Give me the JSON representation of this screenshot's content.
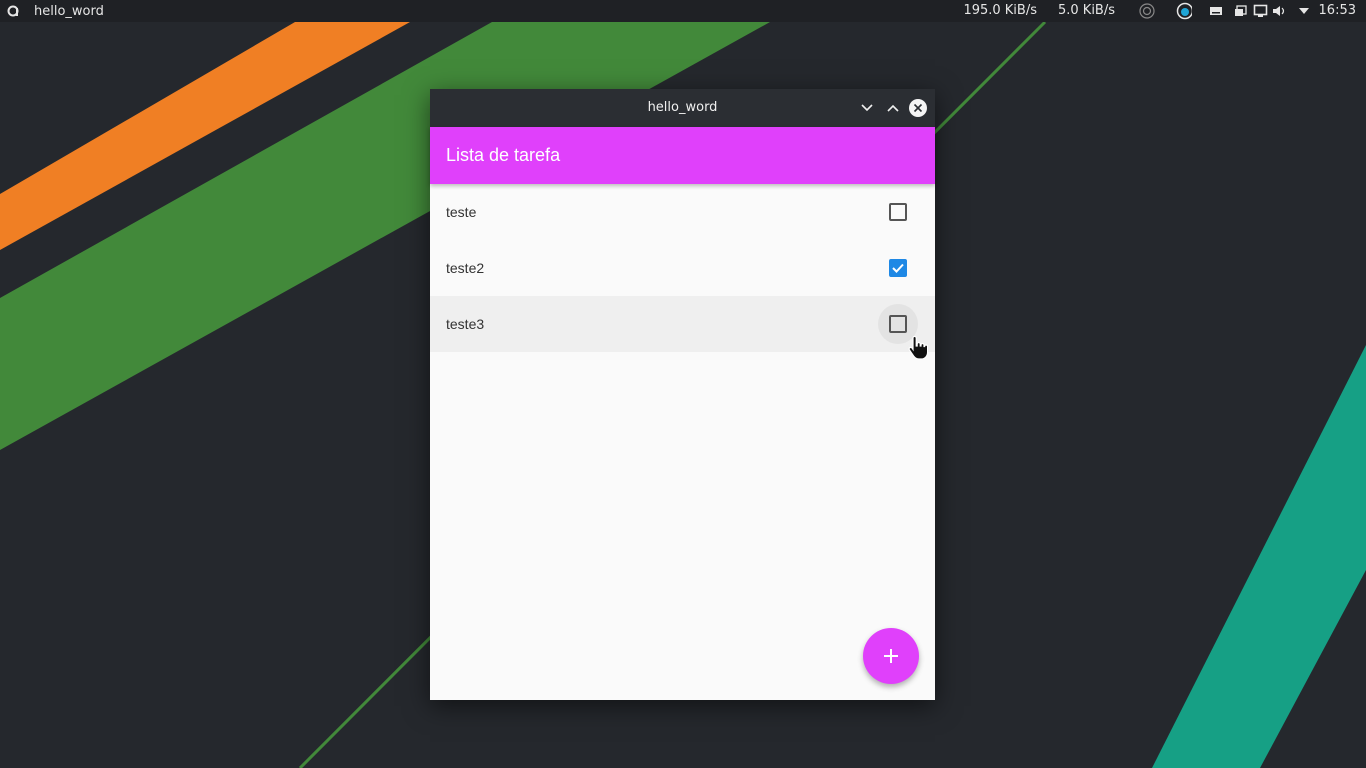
{
  "panel": {
    "active_app": "hello_word",
    "net_down": "195.0 KiB/s",
    "net_up": "5.0 KiB/s",
    "clock": "16:53"
  },
  "window": {
    "title": "hello_word"
  },
  "app": {
    "title": "Lista de tarefa",
    "accent": "#e040fb",
    "check_color": "#1e88e5",
    "tasks": [
      {
        "label": "teste",
        "checked": false
      },
      {
        "label": "teste2",
        "checked": true
      },
      {
        "label": "teste3",
        "checked": false
      }
    ],
    "fab_icon": "plus-icon"
  }
}
